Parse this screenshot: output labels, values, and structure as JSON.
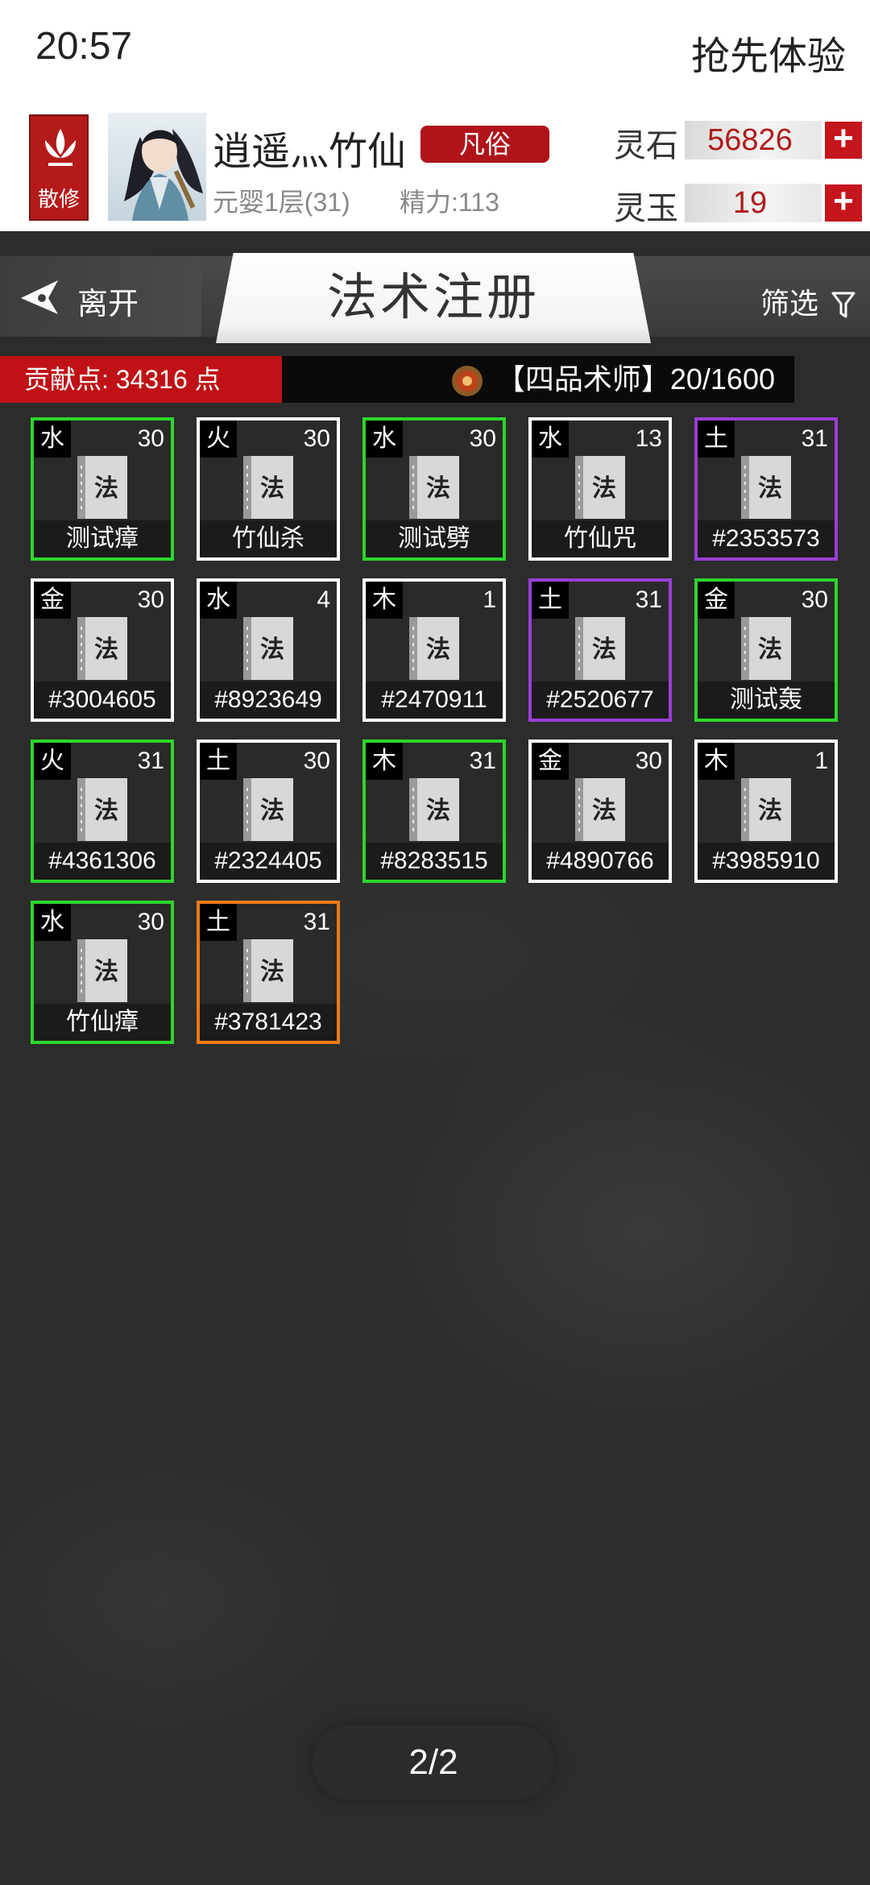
{
  "status_bar": {
    "time": "20:57",
    "experience_label": "抢先体验"
  },
  "player": {
    "badge_label": "散修",
    "name": "逍遥灬竹仙",
    "rank": "凡俗",
    "level": "元婴1层(31)",
    "energy": "精力:113",
    "currencies": [
      {
        "label": "灵石",
        "value": "56826"
      },
      {
        "label": "灵玉",
        "value": "19"
      }
    ]
  },
  "titlebar": {
    "leave_label": "离开",
    "title": "法术注册",
    "filter_label": "筛选"
  },
  "stats": {
    "contribution": "贡献点: 34316 点",
    "master_title": "【四品术师】20/1600"
  },
  "book_glyph": "法",
  "colors": {
    "white": "#ffffff",
    "green": "#2cd62c",
    "purple": "#9a3ed6",
    "orange": "#f07a1a",
    "accent_red": "#c01216"
  },
  "spells": [
    {
      "element": "水",
      "level": "30",
      "name": "测试瘴",
      "rarity": "green"
    },
    {
      "element": "火",
      "level": "30",
      "name": "竹仙杀",
      "rarity": "white"
    },
    {
      "element": "水",
      "level": "30",
      "name": "测试劈",
      "rarity": "green"
    },
    {
      "element": "水",
      "level": "13",
      "name": "竹仙咒",
      "rarity": "white"
    },
    {
      "element": "土",
      "level": "31",
      "name": "#2353573",
      "rarity": "purple"
    },
    {
      "element": "金",
      "level": "30",
      "name": "#3004605",
      "rarity": "white"
    },
    {
      "element": "水",
      "level": "4",
      "name": "#8923649",
      "rarity": "white"
    },
    {
      "element": "木",
      "level": "1",
      "name": "#2470911",
      "rarity": "white"
    },
    {
      "element": "土",
      "level": "31",
      "name": "#2520677",
      "rarity": "purple"
    },
    {
      "element": "金",
      "level": "30",
      "name": "测试轰",
      "rarity": "green"
    },
    {
      "element": "火",
      "level": "31",
      "name": "#4361306",
      "rarity": "green"
    },
    {
      "element": "土",
      "level": "30",
      "name": "#2324405",
      "rarity": "white"
    },
    {
      "element": "木",
      "level": "31",
      "name": "#8283515",
      "rarity": "green"
    },
    {
      "element": "金",
      "level": "30",
      "name": "#4890766",
      "rarity": "white"
    },
    {
      "element": "木",
      "level": "1",
      "name": "#3985910",
      "rarity": "white"
    },
    {
      "element": "水",
      "level": "30",
      "name": "竹仙瘴",
      "rarity": "green"
    },
    {
      "element": "土",
      "level": "31",
      "name": "#3781423",
      "rarity": "orange"
    }
  ],
  "pagination": {
    "label": "2/2"
  }
}
